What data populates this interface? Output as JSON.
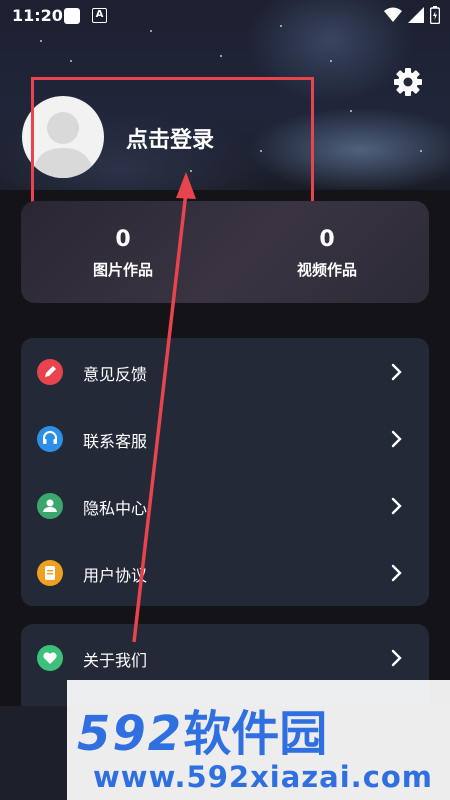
{
  "status_bar": {
    "time": "11:20"
  },
  "profile": {
    "login_text": "点击登录"
  },
  "stats": [
    {
      "count": "0",
      "label": "图片作品"
    },
    {
      "count": "0",
      "label": "视频作品"
    }
  ],
  "menu": [
    {
      "label": "意见反馈",
      "icon": "pencil-icon",
      "color": "#e8444e"
    },
    {
      "label": "联系客服",
      "icon": "headset-icon",
      "color": "#2d8fe8"
    },
    {
      "label": "隐私中心",
      "icon": "privacy-icon",
      "color": "#3aa86e"
    },
    {
      "label": "用户协议",
      "icon": "document-icon",
      "color": "#f0a020"
    }
  ],
  "menu2": [
    {
      "label": "关于我们",
      "icon": "heart-icon",
      "color": "#3cc07a"
    }
  ],
  "watermark": {
    "logo": "592",
    "logo_cn": "软件园",
    "url": "www.592xiazai.com"
  },
  "colors": {
    "highlight": "#e8444e",
    "card": "#242938",
    "watermark_blue": "#2f6fe0"
  }
}
